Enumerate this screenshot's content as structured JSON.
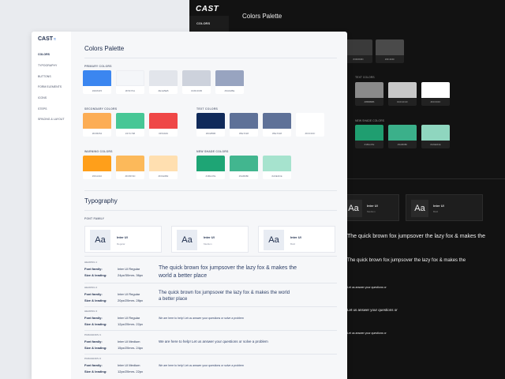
{
  "dark": {
    "logo": "CAST",
    "nav_active": "COLORS",
    "title": "Colors Palette",
    "top_swatches": [
      {
        "hex": "#3a3a3a",
        "label": "#3D3D3D"
      },
      {
        "hex": "#4a4a4a",
        "label": "#4F4F4F"
      }
    ],
    "text_group": "TEXT COLORS",
    "text_swatches": [
      {
        "hex": "#8a8a8a",
        "label": "#8B8B8B"
      },
      {
        "hex": "#c8c8c8",
        "label": "#CFCFCF"
      },
      {
        "hex": "#ffffff",
        "label": "#FFFFFF"
      }
    ],
    "shade_group": "NEW SHADE COLORS",
    "shade_swatches": [
      {
        "hex": "#1f9e70",
        "label": "#1BA47E"
      },
      {
        "hex": "#3bb08a",
        "label": "#3AB08F"
      },
      {
        "hex": "#8fd6bf",
        "label": "#A6E3CE"
      }
    ],
    "cards": [
      {
        "aa": "Aa",
        "name": "Inter UI",
        "weight": "Medium"
      },
      {
        "aa": "Aa",
        "name": "Inter UI",
        "weight": "Bold"
      }
    ],
    "line1": "The quick brown fox jumpsover the lazy fox & makes the",
    "line2": "The quick brown fox jumpsover the lazy fox & makes the",
    "line3": "Let us answer your questions or",
    "line4": "Let us answer your questions or",
    "line5": "Let us answer your questions or"
  },
  "logo": "CAST",
  "nav": [
    "COLORS",
    "TYPOGRAPHY",
    "BUTTONS",
    "FORM ELEMENTS",
    "ICONS",
    "STEPS",
    "SPACING & LAYOUT"
  ],
  "colors_title": "Colors Palette",
  "primary_label": "PRIMARY COLORS",
  "primary": [
    {
      "hex": "#3b86f0",
      "label": "#2D84F5"
    },
    {
      "hex": "#f4f6f9",
      "label": "#F5F7FA"
    },
    {
      "hex": "#e2e5eb",
      "label": "#E1E5EB"
    },
    {
      "hex": "#cdd2dc",
      "label": "#C8CFDB"
    },
    {
      "hex": "#98a4c0",
      "label": "#93A0BE"
    }
  ],
  "secondary_label": "SECONDARY COLORS",
  "secondary": [
    {
      "hex": "#fcad55",
      "label": "#FFB054"
    },
    {
      "hex": "#47c796",
      "label": "#47C798"
    },
    {
      "hex": "#ef4747",
      "label": "#F54949"
    }
  ],
  "text_label": "TEXT COLORS",
  "text_colors": [
    {
      "hex": "#102a5a",
      "label": "#002B5B"
    },
    {
      "hex": "#5e7198",
      "label": "#5E7198"
    },
    {
      "hex": "#5e7198",
      "label": "#5E7198"
    },
    {
      "hex": "#ffffff",
      "label": "#FFFFFF"
    }
  ],
  "warning_label": "WARNING COLORS",
  "warning": [
    {
      "hex": "#ff9f1a",
      "label": "#FFA010"
    },
    {
      "hex": "#fcb95a",
      "label": "#FFB74D"
    },
    {
      "hex": "#ffdfb0",
      "label": "#FFE0B2"
    }
  ],
  "shade_label": "NEW SHADE COLORS",
  "shade": [
    {
      "hex": "#1ea575",
      "label": "#1BA47E"
    },
    {
      "hex": "#42b68f",
      "label": "#3AB08F"
    },
    {
      "hex": "#a6e3ce",
      "label": "#A6E3CE"
    }
  ],
  "typo_title": "Typography",
  "font_family_label": "FONT FAMILY",
  "font_cards": [
    {
      "aa": "Aa",
      "name": "Inter UI",
      "weight": "Regular"
    },
    {
      "aa": "Aa",
      "name": "Inter UI",
      "weight": "Medium"
    },
    {
      "aa": "Aa",
      "name": "Inter UI",
      "weight": "Bold"
    }
  ],
  "styles": [
    {
      "label": "HEADING 1",
      "k1": "Font family:",
      "v1": "Inter UI Regular",
      "k2": "Size & leading:",
      "v2": "24px/30mm- 36px",
      "sample": "The quick brown fox jumpsover the lazy fox & makes the world a better place"
    },
    {
      "label": "HEADING 2",
      "k1": "Font family:",
      "v1": "Inter UI Regular",
      "k2": "Size & leading:",
      "v2": "20px/20mm- 28px",
      "sample": "The quick brown fox jumpsover the lazy fox & makes the world a better place"
    },
    {
      "label": "HEADING 3",
      "k1": "Font family:",
      "v1": "Inter UI Regular",
      "k2": "Size & leading:",
      "v2": "12px/20mm- 22px",
      "sample": "We are here to help! Let us answer your questions or solve a problem"
    },
    {
      "label": "PARAGRAPH 1",
      "k1": "Font family:",
      "v1": "Inter UI Medium",
      "k2": "Size & leading:",
      "v2": "15px/20mm- 24px",
      "sample": "We are here to help! Let us answer your questions or solve a problem"
    },
    {
      "label": "PARAGRAPH 2",
      "k1": "Font family:",
      "v1": "Inter UI Medium",
      "k2": "Size & leading:",
      "v2": "12px/20mm- 22px",
      "sample": "We are here to help! Let us answer your questions or solve a problem"
    }
  ]
}
